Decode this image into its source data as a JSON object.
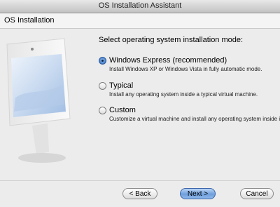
{
  "window": {
    "title": "OS Installation Assistant"
  },
  "header": {
    "title": "OS Installation"
  },
  "main": {
    "prompt": "Select operating system installation mode:",
    "options": [
      {
        "label": "Windows Express (recommended)",
        "description": "Install Windows XP or Windows Vista in fully automatic mode.",
        "selected": true
      },
      {
        "label": "Typical",
        "description": "Install any operating system inside a typical virtual machine.",
        "selected": false
      },
      {
        "label": "Custom",
        "description": "Customize a virtual machine and install any operating system inside it.",
        "selected": false
      }
    ]
  },
  "buttons": {
    "back": "< Back",
    "next": "Next >",
    "cancel": "Cancel"
  },
  "colors": {
    "accent": "#4f87cf",
    "window_bg": "#ececec"
  },
  "icons": {
    "side_image": "imac-icon"
  }
}
